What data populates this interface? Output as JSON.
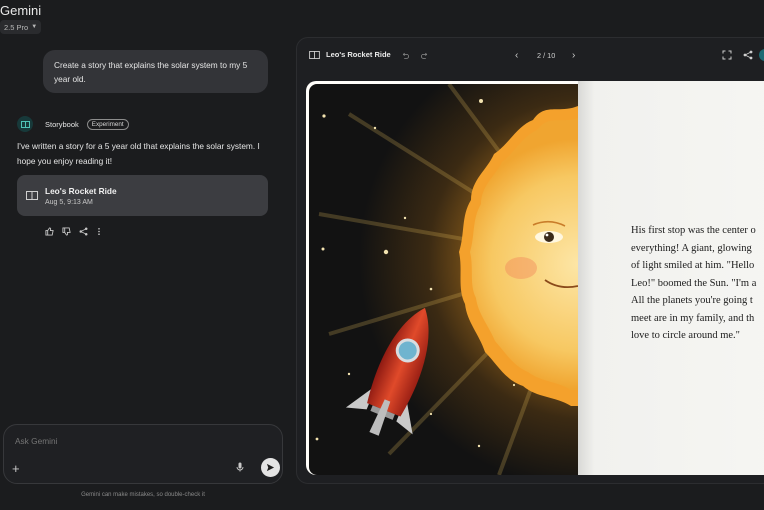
{
  "app": {
    "title": "Gemini",
    "model": "2.5 Pro"
  },
  "chat": {
    "user_prompt": "Create a story that explains the solar system to my 5 year old.",
    "response": {
      "agent_name": "Storybook",
      "badge": "Experiment",
      "text": "I've written a story for a 5 year old that explains the solar system. I hope you enjoy reading it!",
      "card": {
        "title": "Leo's Rocket Ride",
        "date": "Aug 5, 9:13 AM"
      }
    },
    "actions": [
      "thumbs-up-icon",
      "thumbs-down-icon",
      "share-icon",
      "more-icon"
    ]
  },
  "input": {
    "placeholder": "Ask Gemini",
    "disclaimer": "Gemini can make mistakes, so double-check it"
  },
  "viewer": {
    "title": "Leo's Rocket Ride",
    "page_indicator": "2 / 10",
    "page_text": "His first stop was the center o\neverything! A giant, glowing\nof light smiled at him. \"Hello\nLeo!\" boomed the Sun. \"I'm a\nAll the planets you're going t\nmeet are in my family, and th\nlove to circle around me.\""
  },
  "colors": {
    "background": "#1b1c1e",
    "bubble": "#333438",
    "card": "#3c3d41",
    "accent_teal": "#1c6b74"
  }
}
